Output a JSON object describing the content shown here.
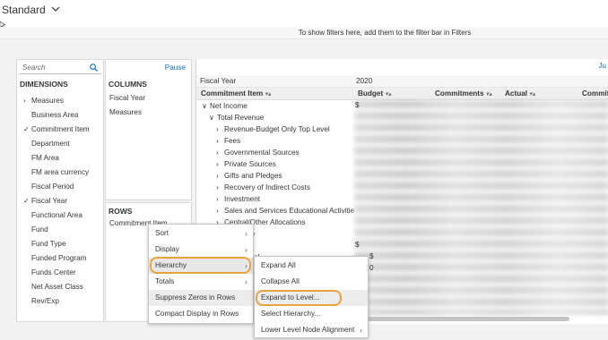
{
  "header": {
    "variant_label": "Standard",
    "filter_hint": "To show filters here, add them to the filter bar in Filters"
  },
  "dimensions": {
    "search_placeholder": "Search",
    "title": "DIMENSIONS",
    "items": [
      {
        "label": "Measures",
        "mark": "›"
      },
      {
        "label": "Business Area",
        "mark": ""
      },
      {
        "label": "Commitment Item",
        "mark": "✓"
      },
      {
        "label": "Department",
        "mark": ""
      },
      {
        "label": "FM Area",
        "mark": ""
      },
      {
        "label": "FM area currency",
        "mark": ""
      },
      {
        "label": "Fiscal Period",
        "mark": ""
      },
      {
        "label": "Fiscal Year",
        "mark": "✓"
      },
      {
        "label": "Functional Area",
        "mark": ""
      },
      {
        "label": "Fund",
        "mark": ""
      },
      {
        "label": "Fund Type",
        "mark": ""
      },
      {
        "label": "Funded Program",
        "mark": ""
      },
      {
        "label": "Funds Center",
        "mark": ""
      },
      {
        "label": "Net Asset Class",
        "mark": ""
      },
      {
        "label": "Rev/Exp",
        "mark": ""
      }
    ]
  },
  "columns": {
    "pause_label": "Pause",
    "title": "COLUMNS",
    "items": [
      "Fiscal Year",
      "Measures"
    ]
  },
  "rows_panel": {
    "title": "ROWS",
    "items": [
      "Commitment Item"
    ]
  },
  "grid": {
    "top_right_label": "Ju",
    "header1": {
      "dim": "Fiscal Year",
      "value": "2020"
    },
    "header2": {
      "dim": "Commitment Item",
      "cols": [
        "Budget",
        "Commitments",
        "Actual",
        "Commit"
      ]
    },
    "sort_glyph": "▾▴",
    "rows": [
      {
        "label": "Net Income",
        "indent": 0,
        "mark": "∨"
      },
      {
        "label": "Total Revenue",
        "indent": 1,
        "mark": "∨"
      },
      {
        "label": "Revenue-Budget Only Top Level",
        "indent": 2,
        "mark": "›"
      },
      {
        "label": "Fees",
        "indent": 2,
        "mark": "›"
      },
      {
        "label": "Governmental Sources",
        "indent": 2,
        "mark": "›"
      },
      {
        "label": "Private Sources",
        "indent": 2,
        "mark": "›"
      },
      {
        "label": "Gifts and Pledges",
        "indent": 2,
        "mark": "›"
      },
      {
        "label": "Recovery of Indirect Costs",
        "indent": 2,
        "mark": "›"
      },
      {
        "label": "Investment",
        "indent": 2,
        "mark": "›"
      },
      {
        "label": "Sales and Services Educational Activitie",
        "indent": 2,
        "mark": "›"
      },
      {
        "label": "Central/Other Allocations",
        "indent": 2,
        "mark": "›"
      },
      {
        "label": "enue",
        "indent": 4,
        "mark": ""
      },
      {
        "label": "se",
        "indent": 4,
        "mark": ""
      },
      {
        "label": "ersonnel",
        "indent": 3,
        "mark": ""
      }
    ],
    "partial_values": [
      "$",
      "$",
      "$",
      "0"
    ]
  },
  "context_menu": {
    "items": [
      {
        "label": "Sort",
        "arrow": "›"
      },
      {
        "label": "Display",
        "arrow": "›"
      },
      {
        "label": "Hierarchy",
        "arrow": "›"
      },
      {
        "label": "Totals",
        "arrow": "›"
      },
      {
        "label": "Suppress Zeros in Rows",
        "arrow": ""
      },
      {
        "label": "Compact Display in Rows",
        "arrow": ""
      }
    ]
  },
  "submenu": {
    "items": [
      {
        "label": "Expand All",
        "arrow": ""
      },
      {
        "label": "Collapse All",
        "arrow": ""
      },
      {
        "label": "Expand to Level...",
        "arrow": ""
      },
      {
        "label": "Select Hierarchy...",
        "arrow": ""
      },
      {
        "label": "Lower Level Node Alignment",
        "arrow": "›"
      }
    ]
  },
  "icons": {
    "search": "search-icon",
    "chevron": "chevron-down-icon"
  },
  "colors": {
    "accent": "#0a6ed1",
    "highlight": "#e8a33d"
  }
}
